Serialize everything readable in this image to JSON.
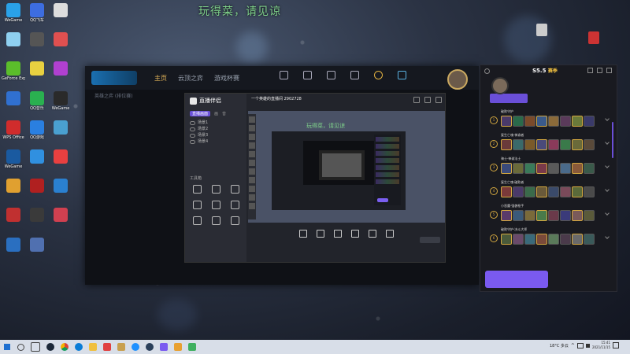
{
  "stream_title": "玩得菜，请见谅",
  "desktop": {
    "icons": [
      {
        "label": "WeGame",
        "color": "#2aa1e8"
      },
      {
        "label": "QQ飞车",
        "color": "#3d6de0"
      },
      {
        "label": "",
        "color": "#ddd"
      },
      {
        "label": "",
        "color": "#8fd0f0"
      },
      {
        "label": "",
        "color": "#555"
      },
      {
        "label": "",
        "color": "#e05050"
      },
      {
        "label": "GeForce Experience",
        "color": "#5bbd2b"
      },
      {
        "label": "",
        "color": "#e8d040"
      },
      {
        "label": "",
        "color": "#b040d0"
      },
      {
        "label": "",
        "color": "#3070d0"
      },
      {
        "label": "QQ音乐",
        "color": "#2ab050"
      },
      {
        "label": "WeGame",
        "color": "#2a2a2a"
      },
      {
        "label": "WPS Office",
        "color": "#d02c2c"
      },
      {
        "label": "QQ游戏",
        "color": "#2a7fe0"
      },
      {
        "label": "",
        "color": "#4aa0d0"
      },
      {
        "label": "WeGame",
        "color": "#1a5aa0"
      },
      {
        "label": "",
        "color": "#3090e0"
      },
      {
        "label": "",
        "color": "#e84040"
      },
      {
        "label": "",
        "color": "#e0a030"
      },
      {
        "label": "",
        "color": "#b02020"
      },
      {
        "label": "",
        "color": "#2a80d0"
      },
      {
        "label": "",
        "color": "#c03030"
      },
      {
        "label": "",
        "color": "#3a3a3a"
      },
      {
        "label": "",
        "color": "#d04050"
      },
      {
        "label": "",
        "color": "#2a6fc0"
      },
      {
        "label": "",
        "color": "#5070b0"
      }
    ],
    "corner_icons": [
      {
        "label": "",
        "pos": "right1"
      },
      {
        "label": "",
        "pos": "right2"
      }
    ]
  },
  "client": {
    "nav": [
      "主页",
      "云顶之弈",
      "游戏杯赛"
    ],
    "tools": [
      "",
      "",
      "",
      "",
      "",
      ""
    ],
    "sub": "英雄之弈 (排位赛)"
  },
  "stream_tool": {
    "brand": "直播伴侣",
    "badge": "",
    "tabs": [
      "直播画面",
      "画",
      "音"
    ],
    "scenes": [
      "场景1",
      "场景2",
      "场景3",
      "场景4"
    ],
    "section": "工具箱",
    "grid": [
      "",
      "",
      "",
      "",
      "",
      "",
      "",
      "",
      ""
    ],
    "footer": "",
    "room": "一个英雄的直播间 2902728",
    "subtext": "玩得菜，请见谅",
    "bar": [
      "",
      "",
      "",
      "",
      "",
      ""
    ],
    "start": ""
  },
  "lol_helper": {
    "title": "S5.5",
    "title_badge": "赛季",
    "user_name": "",
    "user_sub": "",
    "user_tag": "",
    "hint": "",
    "tabs": [
      "",
      "",
      ""
    ],
    "combos": [
      {
        "rank": "1",
        "name": "破败守护",
        "heroes": [
          "#4a3a6a",
          "#2a6a4a",
          "#7a4a2a",
          "#3a5a8a",
          "#8a6a3a",
          "#5a3a5a",
          "#6a7a3a",
          "#3a3a6a"
        ]
      },
      {
        "rank": "2",
        "name": "复生亡魂·神谕者",
        "heroes": [
          "#6a3a3a",
          "#3a6a6a",
          "#7a5a2a",
          "#4a4a7a",
          "#8a3a5a",
          "#3a7a4a",
          "#6a6a3a",
          "#5a4a3a"
        ]
      },
      {
        "rank": "3",
        "name": "骑士·神谕法士",
        "heroes": [
          "#3a4a7a",
          "#6a6a3a",
          "#3a7a5a",
          "#7a3a4a",
          "#5a5a5a",
          "#4a6a8a",
          "#8a5a3a",
          "#3a5a4a"
        ]
      },
      {
        "rank": "4",
        "name": "复生亡魂·破败者",
        "heroes": [
          "#7a3a3a",
          "#4a3a6a",
          "#3a6a4a",
          "#6a5a3a",
          "#3a4a6a",
          "#7a4a5a",
          "#5a6a3a",
          "#4a4a4a"
        ]
      },
      {
        "rank": "5",
        "name": "小恶魔·强袭枪手",
        "heroes": [
          "#5a3a6a",
          "#3a5a7a",
          "#7a6a3a",
          "#4a7a4a",
          "#6a3a4a",
          "#3a3a7a",
          "#7a5a5a",
          "#5a5a3a"
        ]
      },
      {
        "rank": "6",
        "name": "破败守护·决斗大师",
        "heroes": [
          "#4a5a3a",
          "#6a4a6a",
          "#3a6a7a",
          "#7a4a3a",
          "#5a7a5a",
          "#4a3a4a",
          "#6a6a6a",
          "#3a5a5a"
        ]
      }
    ],
    "primary_button": "",
    "more": ""
  },
  "taskbar": {
    "weather": "18°C 多云",
    "time": "15:41",
    "date": "2021/11/15"
  }
}
